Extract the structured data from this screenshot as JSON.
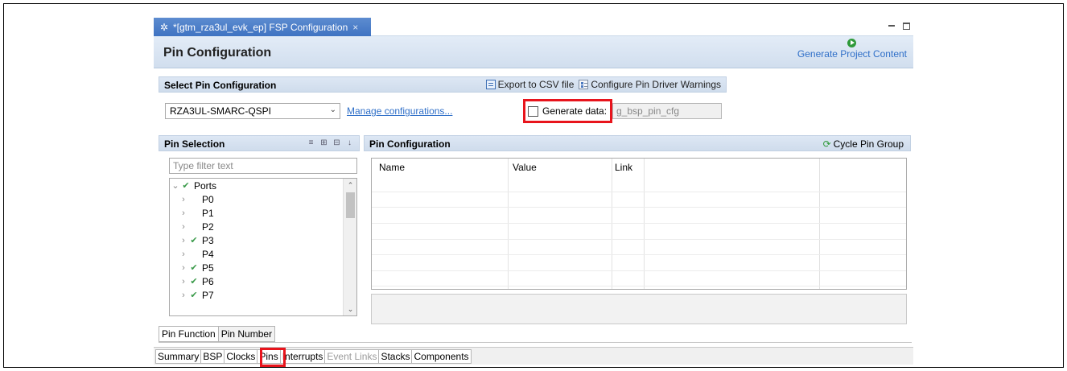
{
  "editor_tab": {
    "title": "*[gtm_rza3ul_evk_ep] FSP Configuration",
    "close_glyph": "×",
    "icon": "gear-icon"
  },
  "header": {
    "title": "Pin Configuration",
    "generate_label": "Generate Project Content"
  },
  "select_section": {
    "title": "Select Pin Configuration",
    "export_label": "Export to CSV file",
    "warnings_label": "Configure Pin Driver Warnings",
    "selected_config": "RZA3UL-SMARC-QSPI",
    "manage_link": "Manage configurations...",
    "generate_data_label": "Generate data:",
    "generate_data_checked": false,
    "generate_data_value": "g_bsp_pin_cfg"
  },
  "pin_selection": {
    "title": "Pin Selection",
    "filter_placeholder": "Type filter text",
    "tree": [
      {
        "label": "Ports",
        "expanded": true,
        "checked": true,
        "level": 0
      },
      {
        "label": "P0",
        "checked": false,
        "level": 1
      },
      {
        "label": "P1",
        "checked": false,
        "level": 1
      },
      {
        "label": "P2",
        "checked": false,
        "level": 1
      },
      {
        "label": "P3",
        "checked": true,
        "level": 1
      },
      {
        "label": "P4",
        "checked": false,
        "level": 1
      },
      {
        "label": "P5",
        "checked": true,
        "level": 1
      },
      {
        "label": "P6",
        "checked": true,
        "level": 1
      },
      {
        "label": "P7",
        "checked": true,
        "level": 1
      }
    ]
  },
  "pin_config": {
    "title": "Pin Configuration",
    "cycle_label": "Cycle Pin Group",
    "columns": [
      "Name",
      "Value",
      "Link"
    ]
  },
  "inner_tabs": [
    "Pin Function",
    "Pin Number"
  ],
  "bottom_tabs": [
    {
      "label": "Summary",
      "disabled": false
    },
    {
      "label": "BSP",
      "disabled": false
    },
    {
      "label": "Clocks",
      "disabled": false
    },
    {
      "label": "Pins",
      "disabled": false,
      "active": true
    },
    {
      "label": "Interrupts",
      "disabled": false
    },
    {
      "label": "Event Links",
      "disabled": true
    },
    {
      "label": "Stacks",
      "disabled": false
    },
    {
      "label": "Components",
      "disabled": false
    }
  ],
  "colors": {
    "tab_active": "#3f73c2",
    "link": "#2f6fc8",
    "highlight": "#e8141c",
    "check": "#3a9a4a"
  }
}
